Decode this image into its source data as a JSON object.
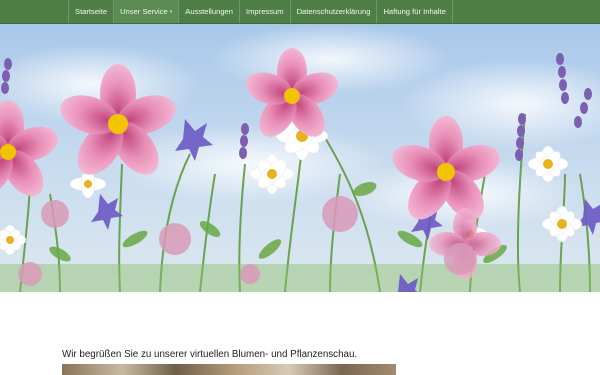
{
  "nav": {
    "items": [
      {
        "label": "Startseite"
      },
      {
        "label": "Unser Service",
        "dropdown_icon": "caret-down-icon"
      },
      {
        "label": "Ausstellungen"
      },
      {
        "label": "Impressum"
      },
      {
        "label": "Datenschutzerklärung"
      },
      {
        "label": "Haftung für Inhalte"
      }
    ],
    "active_index": 1
  },
  "hero": {
    "image": "flower-meadow-banner"
  },
  "content": {
    "welcome_text": "Wir begrüßen Sie zu unserer virtuellen Blumen- und Pflanzenschau.",
    "preview_image": "exhibition-photo-preview"
  },
  "colors": {
    "nav_background": "#4f7f47",
    "nav_text": "#f3f7ef",
    "page_background": "#ffffff",
    "sky_blue": "#9fc2e6"
  }
}
